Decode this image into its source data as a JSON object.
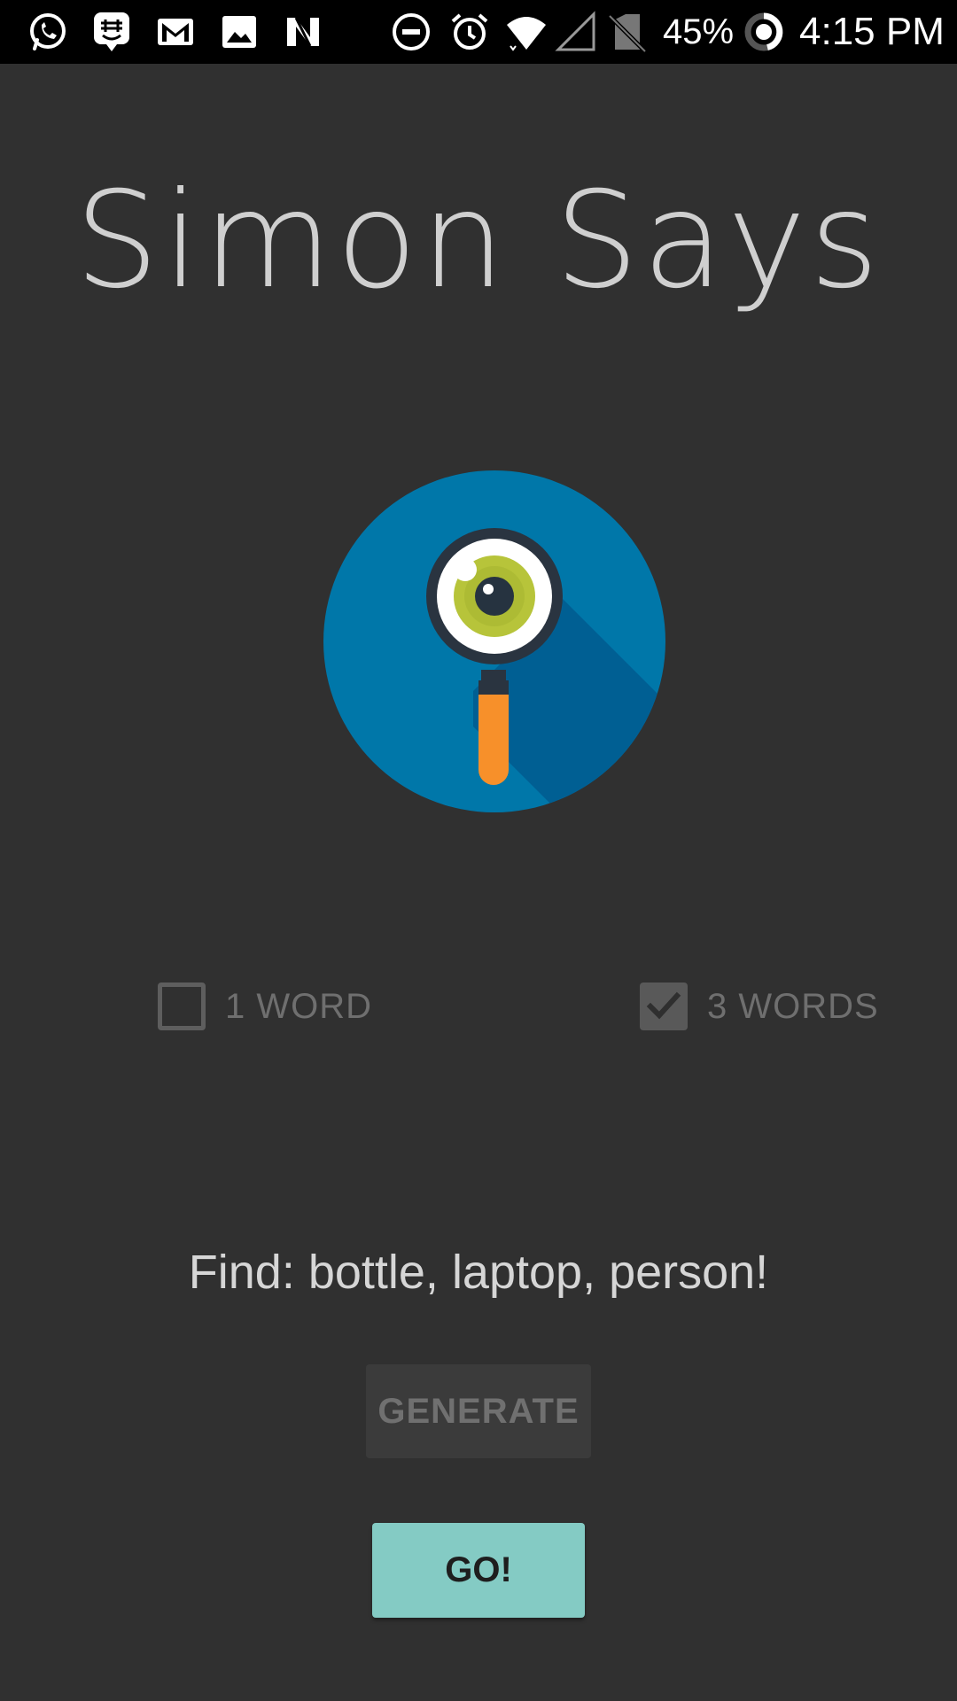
{
  "status_bar": {
    "battery": "45%",
    "time": "4:15 PM",
    "icons": [
      "whatsapp-icon",
      "groupme-icon",
      "gmail-icon",
      "gallery-icon",
      "n-app-icon",
      "do-not-disturb-icon",
      "alarm-icon",
      "wifi-icon",
      "signal-icon",
      "no-sim-icon",
      "battery-icon"
    ]
  },
  "app": {
    "title": "Simon Says",
    "logo_icon": "magnifying-eye-icon"
  },
  "options": {
    "one_word": {
      "label": "1 WORD",
      "checked": false
    },
    "three_words": {
      "label": "3 WORDS",
      "checked": true
    }
  },
  "prompt": {
    "text": "Find: bottle, laptop, person!"
  },
  "buttons": {
    "generate": "GENERATE",
    "go": "GO!"
  },
  "colors": {
    "background": "#303030",
    "accent": "#84cbc4",
    "logo_circle": "#0077a9",
    "logo_handle": "#f7902a"
  }
}
